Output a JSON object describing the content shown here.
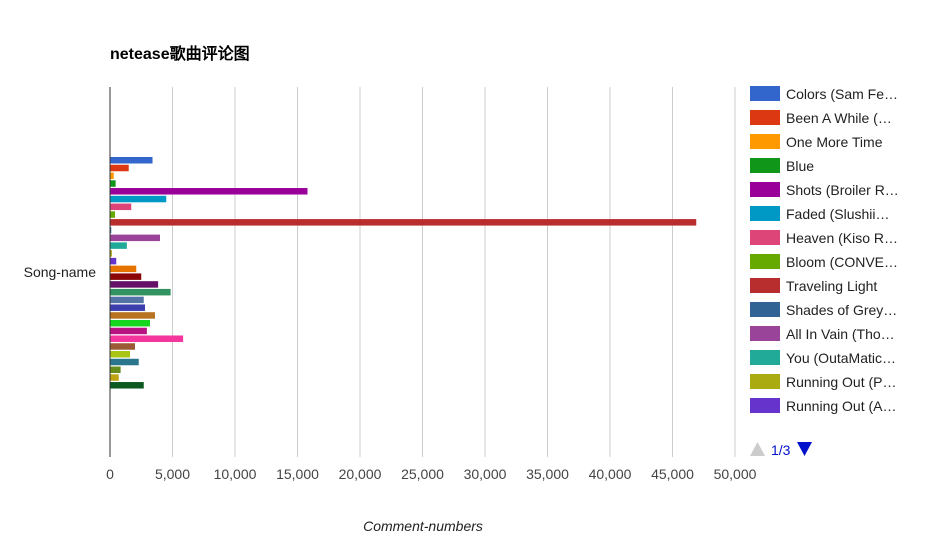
{
  "chart_data": {
    "type": "bar",
    "orientation": "horizontal",
    "title": "netease歌曲评论图",
    "xlabel": "Comment-numbers",
    "ylabel": "",
    "categories": [
      "Song-name"
    ],
    "xlim": [
      0,
      50000
    ],
    "x_ticks": [
      "0",
      "5,000",
      "10,000",
      "15,000",
      "20,000",
      "25,000",
      "30,000",
      "35,000",
      "40,000",
      "45,000",
      "50,000"
    ],
    "grid": true,
    "legend_position": "right",
    "series": [
      {
        "name": "Colors (Sam Fe…",
        "values": [
          3400
        ],
        "color": "#3366cc"
      },
      {
        "name": "Been A While (…",
        "values": [
          1500
        ],
        "color": "#dc3912"
      },
      {
        "name": "One More Time",
        "values": [
          300
        ],
        "color": "#ff9900"
      },
      {
        "name": "Blue",
        "values": [
          450
        ],
        "color": "#109618"
      },
      {
        "name": "Shots (Broiler R…",
        "values": [
          15800
        ],
        "color": "#990099"
      },
      {
        "name": "Faded (Slushii…",
        "values": [
          4500
        ],
        "color": "#0099c6"
      },
      {
        "name": "Heaven (Kiso R…",
        "values": [
          1700
        ],
        "color": "#dd4477"
      },
      {
        "name": "Bloom (CONVE…",
        "values": [
          400
        ],
        "color": "#66aa00"
      },
      {
        "name": "Traveling Light",
        "values": [
          46900
        ],
        "color": "#b82e2e"
      },
      {
        "name": "Shades of Grey…",
        "values": [
          100
        ],
        "color": "#316395"
      },
      {
        "name": "All In Vain (Tho…",
        "values": [
          4000
        ],
        "color": "#994499"
      },
      {
        "name": "You (OutaMatic…",
        "values": [
          1350
        ],
        "color": "#22aa99"
      },
      {
        "name": "Running Out (P…",
        "values": [
          150
        ],
        "color": "#aaaa11"
      },
      {
        "name": "Running Out (A…",
        "values": [
          500
        ],
        "color": "#6633cc"
      },
      {
        "name": "",
        "values": [
          2100
        ],
        "color": "#e67300"
      },
      {
        "name": "",
        "values": [
          2500
        ],
        "color": "#8b0707"
      },
      {
        "name": "",
        "values": [
          3850
        ],
        "color": "#651067"
      },
      {
        "name": "",
        "values": [
          4850
        ],
        "color": "#329262"
      },
      {
        "name": "",
        "values": [
          2700
        ],
        "color": "#5574a6"
      },
      {
        "name": "",
        "values": [
          2800
        ],
        "color": "#3b3eac"
      },
      {
        "name": "",
        "values": [
          3600
        ],
        "color": "#b77322"
      },
      {
        "name": "",
        "values": [
          3200
        ],
        "color": "#16d620"
      },
      {
        "name": "",
        "values": [
          2950
        ],
        "color": "#b91383"
      },
      {
        "name": "",
        "values": [
          5850
        ],
        "color": "#f4359e"
      },
      {
        "name": "",
        "values": [
          2000
        ],
        "color": "#9c5935"
      },
      {
        "name": "",
        "values": [
          1600
        ],
        "color": "#a9c413"
      },
      {
        "name": "",
        "values": [
          2300
        ],
        "color": "#2a778d"
      },
      {
        "name": "",
        "values": [
          850
        ],
        "color": "#668d1c"
      },
      {
        "name": "",
        "values": [
          700
        ],
        "color": "#bea413"
      },
      {
        "name": "",
        "values": [
          2700
        ],
        "color": "#0c5922"
      }
    ]
  },
  "legend": {
    "page_indicator": "1/3",
    "prev_arrow_color": "#cccccc",
    "next_arrow_color": "#0011cc"
  }
}
